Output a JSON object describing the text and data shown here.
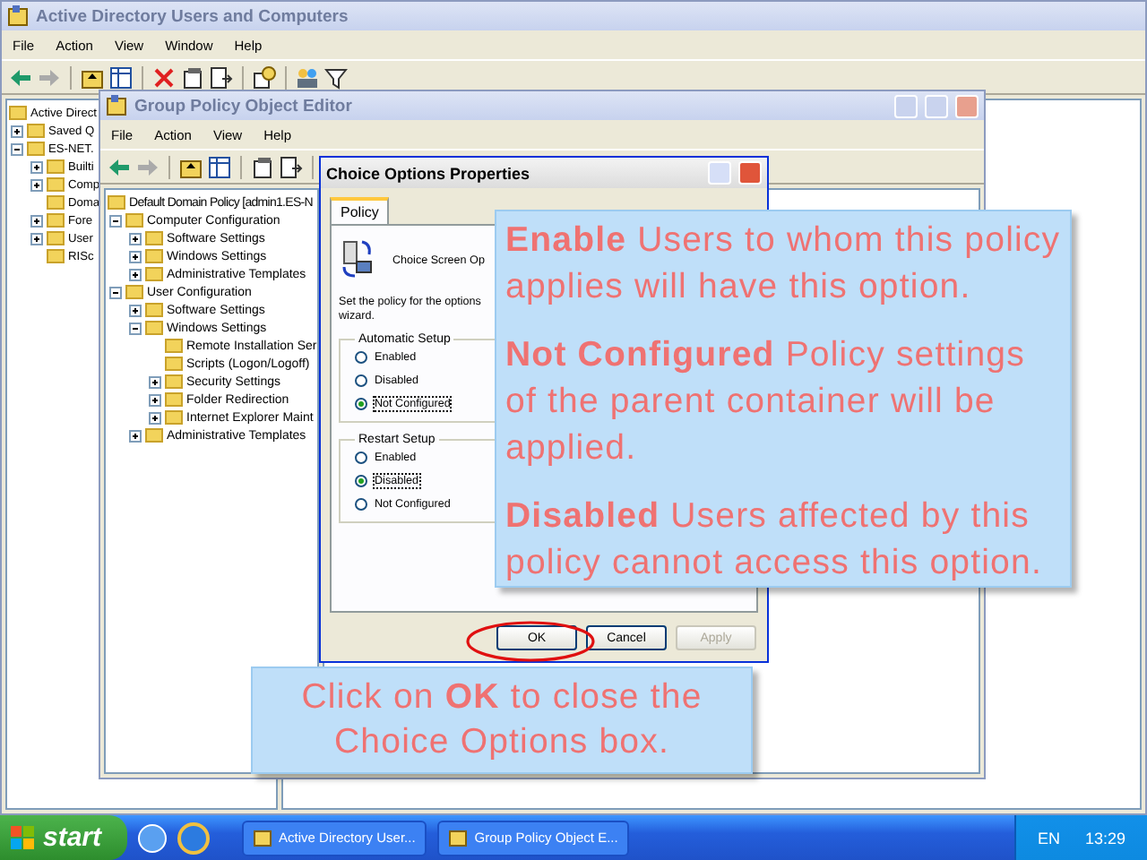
{
  "aduc_window": {
    "title": "Active Directory Users and Computers",
    "menu": [
      "File",
      "Action",
      "View",
      "Window",
      "Help"
    ],
    "tree": [
      {
        "label": "Active Direct",
        "children": [
          {
            "label": "Saved Q",
            "expanded": false
          },
          {
            "label": "ES-NET.",
            "expanded": true,
            "children": [
              {
                "label": "Builti",
                "expanded": false
              },
              {
                "label": "Comp",
                "expanded": false
              },
              {
                "label": "Doma"
              },
              {
                "label": "Fore",
                "expanded": false
              },
              {
                "label": "User",
                "expanded": false
              },
              {
                "label": "RISc"
              }
            ]
          }
        ]
      }
    ]
  },
  "gpo_window": {
    "title": "Group Policy Object Editor",
    "menu": [
      "File",
      "Action",
      "View",
      "Help"
    ],
    "tree": [
      {
        "label": "Default Domain Policy [admin1.ES-N",
        "children": [
          {
            "label": "Computer Configuration",
            "expanded": true,
            "children": [
              {
                "label": "Software Settings",
                "expanded": false
              },
              {
                "label": "Windows Settings",
                "expanded": false
              },
              {
                "label": "Administrative Templates",
                "expanded": false
              }
            ]
          },
          {
            "label": "User Configuration",
            "expanded": true,
            "children": [
              {
                "label": "Software Settings",
                "expanded": false
              },
              {
                "label": "Windows Settings",
                "expanded": true,
                "children": [
                  {
                    "label": "Remote Installation Ser"
                  },
                  {
                    "label": "Scripts (Logon/Logoff)"
                  },
                  {
                    "label": "Security Settings",
                    "expanded": false
                  },
                  {
                    "label": "Folder Redirection",
                    "expanded": false
                  },
                  {
                    "label": "Internet Explorer Maint",
                    "expanded": false
                  }
                ]
              },
              {
                "label": "Administrative Templates",
                "expanded": false
              }
            ]
          }
        ]
      }
    ]
  },
  "dialog": {
    "title": "Choice Options Properties",
    "tabs": [
      {
        "label": "Policy",
        "selected": true
      }
    ],
    "policy_name": "Choice Screen Op",
    "description": "Set the policy for the options",
    "description_end": "wizard.",
    "groups": [
      {
        "label": "Automatic Setup",
        "options": [
          {
            "label": "Enabled",
            "selected": false
          },
          {
            "label": "Disabled",
            "selected": false
          },
          {
            "label": "Not Configured",
            "selected": true
          }
        ]
      },
      {
        "label": "Restart Setup",
        "options": [
          {
            "label": "Enabled",
            "selected": false
          },
          {
            "label": "Disabled",
            "selected": true
          },
          {
            "label": "Not Configured",
            "selected": false
          }
        ]
      }
    ],
    "buttons": [
      {
        "label": "OK",
        "disabled": false
      },
      {
        "label": "Cancel",
        "disabled": false
      },
      {
        "label": "Apply",
        "disabled": true
      }
    ]
  },
  "callout": {
    "paragraphs": [
      "**Enable** Users to whom this policy applies will have this option.",
      "**Not Configured** Policy settings of the parent container will be applied.",
      "**Disabled** Users affected by this policy cannot access this option."
    ]
  },
  "hint_callout": {
    "text": "Click on **OK** to close the Choice Options box."
  },
  "taskbar": {
    "start": "start",
    "tasks": [
      {
        "label": "Active Directory User..."
      },
      {
        "label": "Group Policy Object E..."
      }
    ],
    "language": "EN",
    "clock": "13:29"
  }
}
